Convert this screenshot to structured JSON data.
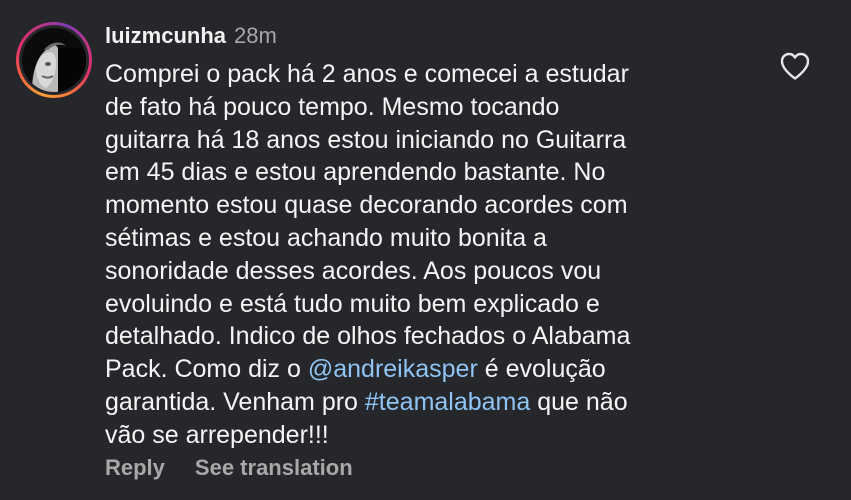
{
  "comment": {
    "username": "luizmcunha",
    "time": "28m",
    "text_lines": [
      "Comprei o pack há 2 anos e comecei a estudar",
      "de fato há pouco tempo.  Mesmo tocando",
      "guitarra há 18 anos estou iniciando no Guitarra",
      "em 45 dias e estou aprendendo bastante. No",
      "momento estou quase decorando acordes com",
      "sétimas e estou achando muito bonita a",
      "sonoridade desses acordes. Aos poucos vou",
      "evoluindo e está tudo muito bem explicado e",
      "detalhado. Indico de olhos fechados o Alabama",
      "Pack. Como diz o "
    ],
    "mention": "@andreikasper",
    "after_mention": " é evolução",
    "line_before_hashtag": "garantida. Venham pro ",
    "hashtag": "#teamalabama",
    "after_hashtag": " que não",
    "last_line": "vão se arrepender!!!"
  },
  "actions": {
    "reply_label": "Reply",
    "translate_label": "See translation"
  },
  "icons": {
    "like": "heart-outline-icon",
    "avatar": "profile-avatar"
  },
  "colors": {
    "background": "#25272b",
    "text": "#f5f5f5",
    "muted": "#a8a8a8",
    "link": "#8fc4f5"
  }
}
